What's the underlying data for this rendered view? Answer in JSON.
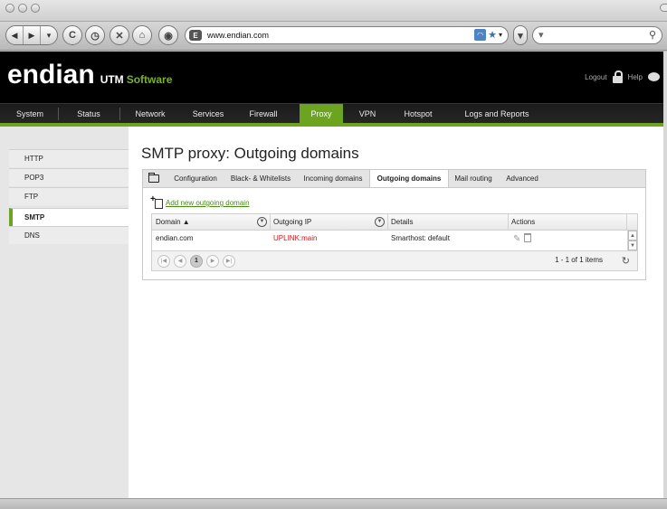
{
  "browser": {
    "url": "www.endian.com",
    "favicon": "E",
    "search_placeholder": ""
  },
  "header": {
    "brand_name": "endian",
    "brand_utm": "UTM",
    "brand_software": "Software",
    "logout_label": "Logout",
    "help_label": "Help"
  },
  "menu": {
    "items": [
      "System",
      "Status",
      "Network",
      "Services",
      "Firewall",
      "Proxy",
      "VPN",
      "Hotspot",
      "Logs and Reports"
    ],
    "active": "Proxy"
  },
  "sidebar": {
    "items": [
      "HTTP",
      "POP3",
      "FTP",
      "SMTP",
      "DNS"
    ],
    "active": "SMTP"
  },
  "page": {
    "title": "SMTP proxy: Outgoing domains",
    "tabs": [
      "Configuration",
      "Black- & Whitelists",
      "Incoming domains",
      "Outgoing domains",
      "Mail routing",
      "Advanced"
    ],
    "active_tab": "Outgoing domains",
    "add_link": "Add new outgoing domain"
  },
  "grid": {
    "columns": [
      "Domain ▲",
      "Outgoing IP",
      "Details",
      "Actions"
    ],
    "rows": [
      {
        "domain": "endian.com",
        "outgoing_ip": "UPLINK:main",
        "details": "Smarthost: default"
      }
    ],
    "pager": {
      "current_page": "1",
      "status": "1 - 1 of 1 items"
    }
  },
  "colors": {
    "accent": "#6ca31f",
    "brand_software": "#7ab02e",
    "error_red": "#d0181e"
  }
}
